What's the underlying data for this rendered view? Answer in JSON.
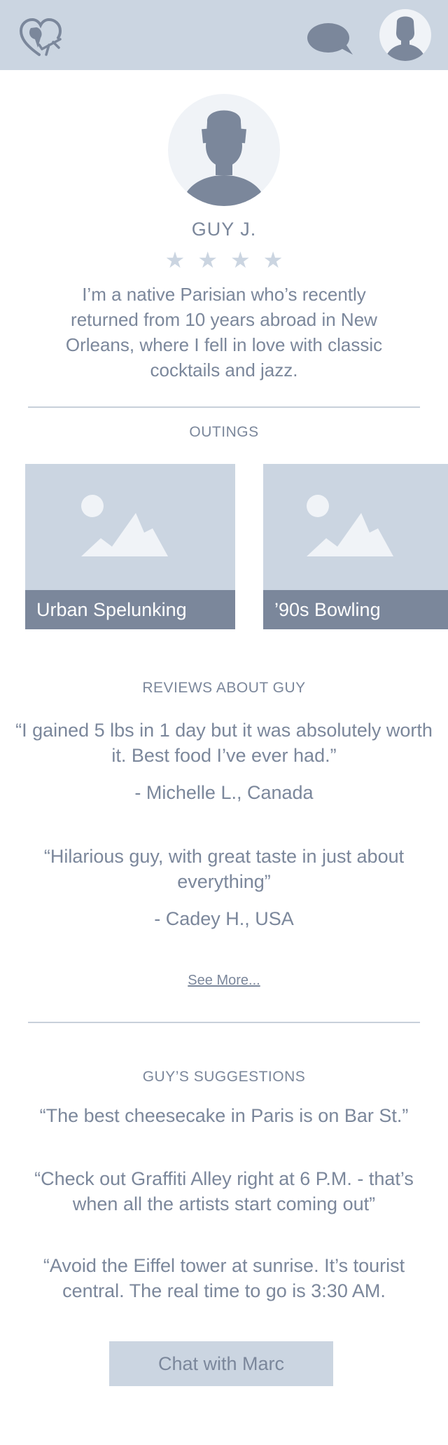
{
  "header": {
    "logo_icon": "heart-plane-logo",
    "chat_icon": "speech-bubble-icon",
    "avatar_icon": "user-avatar-icon"
  },
  "profile": {
    "name": "GUY J.",
    "rating": 4,
    "stars": "★★★★",
    "bio": "I’m a native Parisian who’s recently returned from 10 years abroad in New Orleans, where I fell in love with classic cocktails and jazz."
  },
  "outings": {
    "title": "OUTINGS",
    "items": [
      {
        "label": "Urban Spelunking"
      },
      {
        "label": "’90s Bowling"
      }
    ]
  },
  "reviews": {
    "title": "REVIEWS ABOUT GUY",
    "items": [
      {
        "quote": "“I gained 5 lbs in 1 day but it was absolutely worth it. Best food I’ve ever had.”",
        "author": "- Michelle L., Canada"
      },
      {
        "quote": "“Hilarious guy, with great taste in just about everything”",
        "author": "- Cadey H., USA"
      }
    ],
    "see_more": "See More..."
  },
  "suggestions": {
    "title": "GUY’S SUGGESTIONS",
    "items": [
      "“The best cheesecake in Paris is on Bar St.”",
      "“Check out Graffiti Alley right at 6 P.M. - that’s when all the artists start coming out”",
      "“Avoid the Eiffel tower at sunrise. It’s tourist central. The real time to go is 3:30 AM."
    ]
  },
  "cta": {
    "label": "Chat with Marc"
  },
  "colors": {
    "header_bg": "#cbd5e1",
    "text": "#7b879b",
    "card_label_bg": "#7b879b",
    "avatar_bg": "#f0f3f7"
  }
}
